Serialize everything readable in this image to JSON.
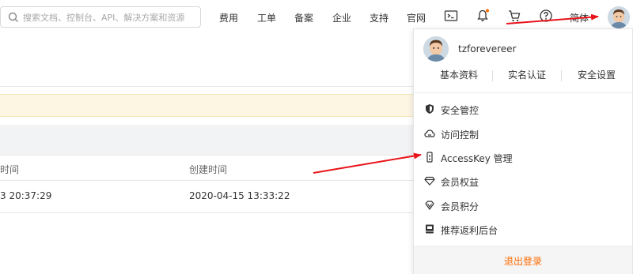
{
  "header": {
    "search_placeholder": "搜索文档、控制台、API、解决方案和资源",
    "nav": [
      "费用",
      "工单",
      "备案",
      "企业",
      "支持",
      "官网"
    ],
    "lang": "简体",
    "icons": [
      "terminal-icon",
      "bell-icon",
      "cart-icon",
      "help-icon"
    ]
  },
  "table": {
    "columns": [
      "时间",
      "创建时间"
    ],
    "rows": [
      [
        "3 20:37:29",
        "2020-04-15 13:33:22"
      ]
    ]
  },
  "user_menu": {
    "username": "tzforevereer",
    "links": [
      "基本资料",
      "实名认证",
      "安全设置"
    ],
    "items": [
      {
        "label": "安全管控",
        "icon": "shield-icon"
      },
      {
        "label": "访问控制",
        "icon": "cloud-icon"
      },
      {
        "label": "AccessKey 管理",
        "icon": "key-icon"
      },
      {
        "label": "会员权益",
        "icon": "diamond-icon"
      },
      {
        "label": "会员积分",
        "icon": "gem-icon"
      },
      {
        "label": "推荐返利后台",
        "icon": "book-icon"
      }
    ],
    "logout": "退出登录"
  },
  "colors": {
    "accent": "#ff6a00",
    "arrow": "#e8141b",
    "notice_bg": "#fdf6e3",
    "table_head_bg": "#f2f3f5"
  }
}
